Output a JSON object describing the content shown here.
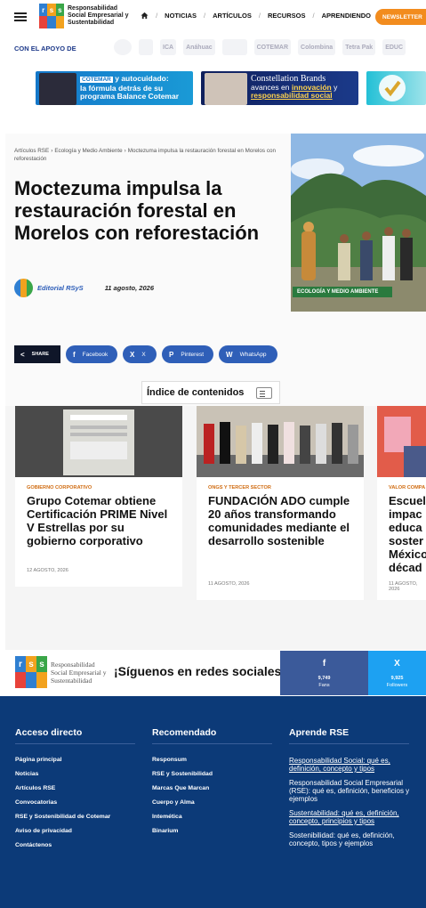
{
  "header": {
    "logo_letters": [
      "r",
      "s",
      "s"
    ],
    "logo_text": "Responsabilidad Social Empresarial y Sustentabilidad",
    "nav": [
      "NOTICIAS",
      "ARTÍCULOS",
      "RECURSOS",
      "APRENDIENDO"
    ],
    "newsletter": "NEWSLETTER"
  },
  "sponsors": {
    "label": "CON EL APOYO DE",
    "logos": [
      "",
      "",
      "ICA",
      "Anáhuac",
      "",
      "COTEMAR",
      "Colombina",
      "Tetra Pak",
      "EDUC"
    ]
  },
  "banners": {
    "b1_brand": "COTEMAR",
    "b1_line1": "y autocuidado:",
    "b1_line2": "la fórmula detrás de su",
    "b1_line3": "programa Balance Cotemar",
    "b2_brand": "Constellation Brands",
    "b2_line1": "avances en",
    "b2_line1_hl": "innovación",
    "b2_line1_end": "y",
    "b2_line2": "responsabilidad social"
  },
  "article": {
    "breadcrumb": [
      "Artículos RSE",
      "Ecología y Medio Ambiente",
      "Moctezuma impulsa la restauración forestal en Morelos con reforestación"
    ],
    "title": "Moctezuma impulsa la restauración forestal en Morelos con reforestación",
    "author": "Editorial RSyS",
    "date": "11 agosto, 2026",
    "category": "ECOLOGÍA Y MEDIO AMBIENTE"
  },
  "share": {
    "label": "SHARE",
    "buttons": [
      {
        "icon": "f",
        "label": "Facebook"
      },
      {
        "icon": "X",
        "label": "X"
      },
      {
        "icon": "P",
        "label": "Pinterest"
      },
      {
        "icon": "W",
        "label": "WhatsApp"
      }
    ]
  },
  "toc": {
    "label": "Índice de contenidos"
  },
  "cards": [
    {
      "category": "GOBIERNO CORPORATIVO",
      "title": "Grupo Cotemar obtiene Certificación PRIME Nivel V Estrellas por su gobierno corporativo",
      "date": "12 AGOSTO, 2026"
    },
    {
      "category": "ONGS Y TERCER SECTOR",
      "title": "FUNDACIÓN ADO cumple 20 años transformando comunidades mediante el desarrollo sostenible",
      "date": "11 AGOSTO, 2026"
    },
    {
      "category": "VALOR COMPA",
      "title": "Escuel impac educa soster México décad",
      "date": "11 AGOSTO, 2026"
    }
  ],
  "follow": {
    "logo_text": "Responsabilidad Social Empresarial y Sustentabilidad",
    "text": "¡Síguenos en redes sociales!",
    "facebook": {
      "icon": "f",
      "count": "9,749",
      "label": "Fans"
    },
    "x": {
      "icon": "X",
      "count": "9,925",
      "label": "Followers"
    }
  },
  "footer": {
    "col1": {
      "title": "Acceso directo",
      "links": [
        "Página principal",
        "Noticias",
        "Artículos RSE",
        "Convocatorias",
        "RSE y Sostenibilidad de Cotemar",
        "Aviso de privacidad",
        "Contáctenos"
      ]
    },
    "col2": {
      "title": "Recomendado",
      "links": [
        "Responsum",
        "RSE y Sostenibilidad",
        "Marcas Que Marcan",
        "Cuerpo y Alma",
        "Intemética",
        "Binarium"
      ]
    },
    "col3": {
      "title": "Aprende RSE",
      "links": [
        "Responsabilidad Social: qué es, definición, concepto y tipos",
        "Responsabilidad Social Empresarial (RSE): qué es, definición, beneficios y ejemplos",
        "Sustentabilidad: qué es, definición, concepto, principios y tipos",
        "Sostenibilidad: qué es, definición, concepto, tipos y ejemplos"
      ]
    }
  },
  "colors": {
    "accent": "#f28c1e",
    "footer_bg": "#0c3a78",
    "share_blue": "#2f5fb8",
    "category_orange": "#d06c12",
    "tag_green": "#2a7a3e"
  }
}
